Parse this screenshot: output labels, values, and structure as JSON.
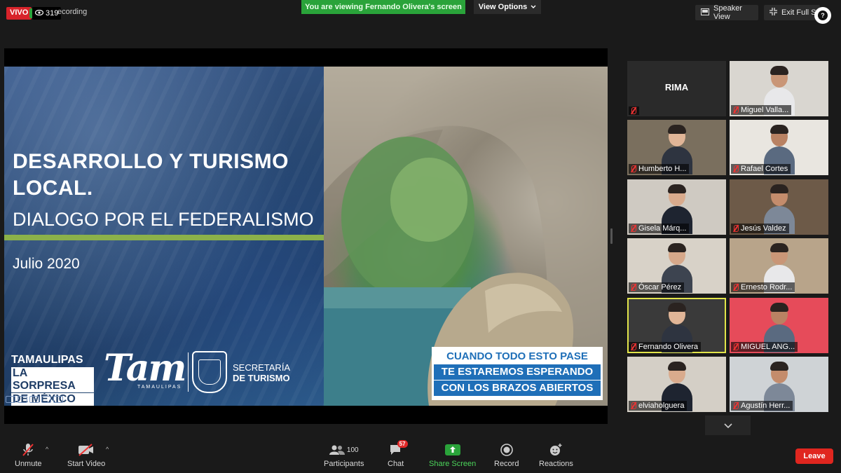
{
  "top": {
    "live_label": "VIVO",
    "viewer_count": "319",
    "recording_label": "ecording",
    "viewing_banner": "You are viewing Fernando Olivera's screen",
    "view_options": "View Options",
    "speaker_view": "Speaker View",
    "exit_full_screen": "Exit Full Sc"
  },
  "slide": {
    "title_line1": "DESARROLLO Y TURISMO",
    "title_line2": "LOCAL.",
    "subtitle": "DIALOGO POR EL FEDERALISMO",
    "date": "Julio 2020",
    "brand_l1": "TAMAULIPAS",
    "brand_l2": "LA SORPRESA",
    "brand_l3": "DE MÉXICO",
    "tam_logo": "Tam",
    "tam_sub": "TAMAULIPAS",
    "secretaria_l1": "SECRETARÍA",
    "secretaria_l2": "DE TURISMO",
    "banner_l1": "CUANDO TODO ESTO PASE",
    "banner_l2": "TE ESTAREMOS ESPERANDO",
    "banner_l3": "CON LOS BRAZOS ABIERTOS"
  },
  "participants": [
    {
      "name": "",
      "display_text": "RIMA"
    },
    {
      "name": "Miguel Valla..."
    },
    {
      "name": "Humberto H..."
    },
    {
      "name": "Rafael Cortes"
    },
    {
      "name": "Gisela Márq..."
    },
    {
      "name": "Jesús Valdez"
    },
    {
      "name": "Óscar Pérez"
    },
    {
      "name": "Ernesto Rodr..."
    },
    {
      "name": "Fernando Olivera"
    },
    {
      "name": "MIGUEL ANG..."
    },
    {
      "name": "elviaholguera"
    },
    {
      "name": "Agustín Herr..."
    }
  ],
  "toolbar": {
    "unmute": "Unmute",
    "start_video": "Start Video",
    "participants": "Participants",
    "participants_count": "100",
    "chat": "Chat",
    "chat_badge": "57",
    "share_screen": "Share Screen",
    "record": "Record",
    "reactions": "Reactions",
    "leave": "Leave"
  },
  "colors": {
    "accent_green": "#2aa33a",
    "leave_red": "#e0261f",
    "active_speaker": "#e2e54a"
  }
}
